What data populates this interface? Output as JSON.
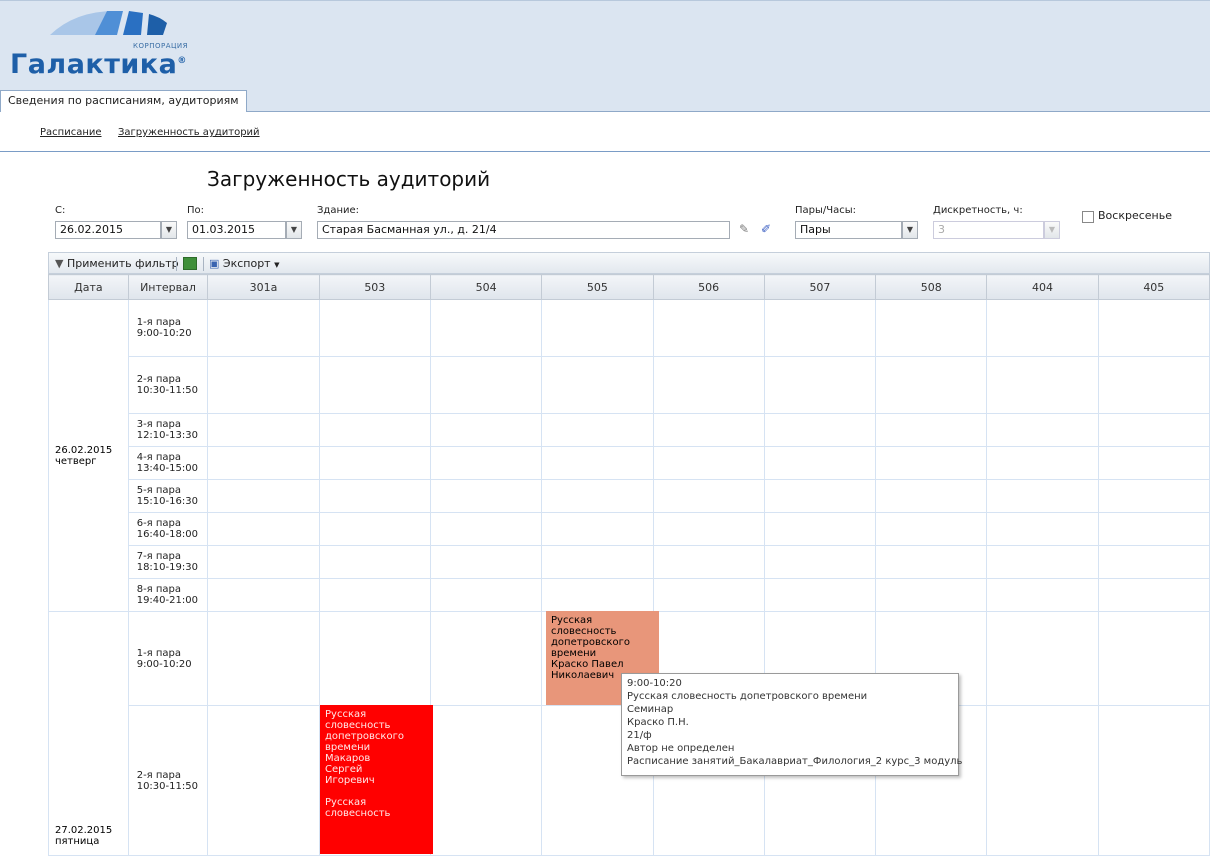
{
  "header": {
    "logo_small": "КОРПОРАЦИЯ",
    "logo_name": "Галактика",
    "logo_reg": "®",
    "brand_color": "#1e5fa8",
    "tab_label": "Сведения по расписаниям, аудиториям"
  },
  "subnav": [
    "Расписание",
    "Загруженность аудиторий"
  ],
  "page_title": "Загруженность аудиторий",
  "filters": {
    "from_label": "С:",
    "from_value": "26.02.2015",
    "to_label": "По:",
    "to_value": "01.03.2015",
    "building_label": "Здание:",
    "building_value": "Старая Басманная ул., д. 21/4",
    "pairs_label": "Пары/Часы:",
    "pairs_value": "Пары",
    "discrete_label": "Дискретность, ч:",
    "discrete_value": "3",
    "sunday_label": "Воскресенье",
    "sunday_checked": false
  },
  "toolbar": {
    "apply_filter": "Применить фильтр",
    "export": "Экспорт"
  },
  "grid": {
    "columns": [
      "Дата",
      "Интервал",
      "301а",
      "503",
      "504",
      "505",
      "506",
      "507",
      "508",
      "404",
      "405"
    ],
    "days": [
      {
        "date": "26.02.2015",
        "weekday": "четверг",
        "intervals": [
          "1-я пара\n9:00-10:20",
          "2-я пара\n10:30-11:50",
          "3-я пара\n12:10-13:30",
          "4-я пара\n13:40-15:00",
          "5-я пара\n15:10-16:30",
          "6-я пара\n16:40-18:00",
          "7-я пара\n18:10-19:30",
          "8-я пара\n19:40-21:00"
        ]
      },
      {
        "date": "27.02.2015",
        "weekday": "пятница",
        "intervals": [
          "1-я пара\n9:00-10:20",
          "2-я пара\n10:30-11:50"
        ]
      }
    ]
  },
  "events": [
    {
      "room": "505",
      "text": "Русская\nсловесность\nдопетровского\nвремени\nКраско Павел\nНиколаевич",
      "color": "#e8967a"
    },
    {
      "room": "503",
      "text": "Русская\nсловесность\nдопетровского\nвремени\nМакаров\nСергей\nИгоревич\n\nРусская\nсловесность",
      "color": "#ff0000"
    }
  ],
  "tooltip": [
    "9:00-10:20",
    "Русская словесность допетровского времени",
    "Семинар",
    "Краско П.Н.",
    "21/ф",
    "Автор не определен",
    "Расписание занятий_Бакалавриат_Филология_2 курс_3 модуль"
  ]
}
